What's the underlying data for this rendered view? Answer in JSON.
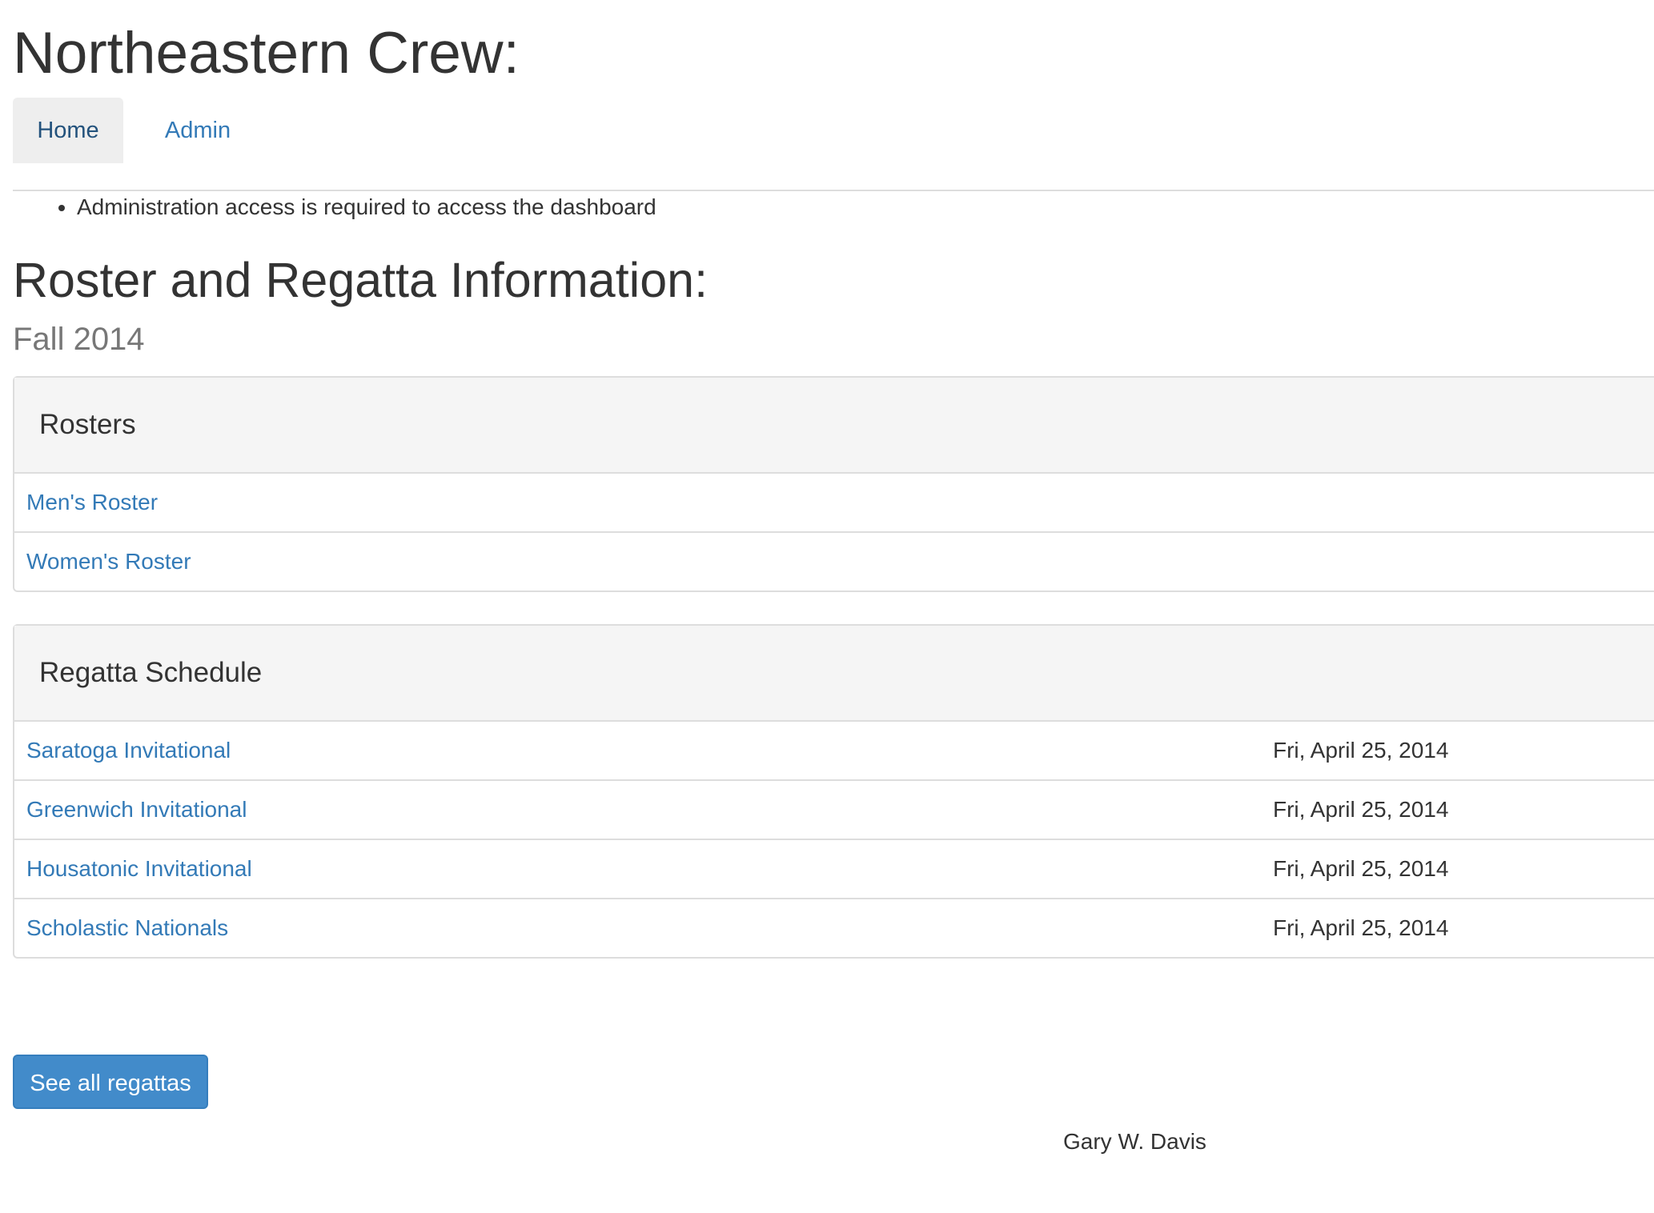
{
  "header": {
    "title": "Northeastern Crew:"
  },
  "nav": {
    "tabs": [
      {
        "label": "Home",
        "active": true
      },
      {
        "label": "Admin",
        "active": false
      }
    ]
  },
  "notices": [
    "Administration access is required to access the dashboard"
  ],
  "main": {
    "title": "Roster and Regatta Information:",
    "season": "Fall 2014"
  },
  "rosters": {
    "heading": "Rosters",
    "items": [
      {
        "label": "Men's Roster"
      },
      {
        "label": "Women's Roster"
      }
    ]
  },
  "schedule": {
    "heading": "Regatta Schedule",
    "items": [
      {
        "name": "Saratoga Invitational",
        "date": "Fri, April 25, 2014"
      },
      {
        "name": "Greenwich Invitational",
        "date": "Fri, April 25, 2014"
      },
      {
        "name": "Housatonic Invitational",
        "date": "Fri, April 25, 2014"
      },
      {
        "name": "Scholastic Nationals",
        "date": "Fri, April 25, 2014"
      }
    ]
  },
  "actions": {
    "see_all_label": "See all regattas"
  },
  "footer": {
    "author": "Gary W. Davis"
  },
  "colors": {
    "link": "#337ab7",
    "primary": "#428bca",
    "panel_heading_bg": "#f5f5f5",
    "border": "#dddddd"
  }
}
